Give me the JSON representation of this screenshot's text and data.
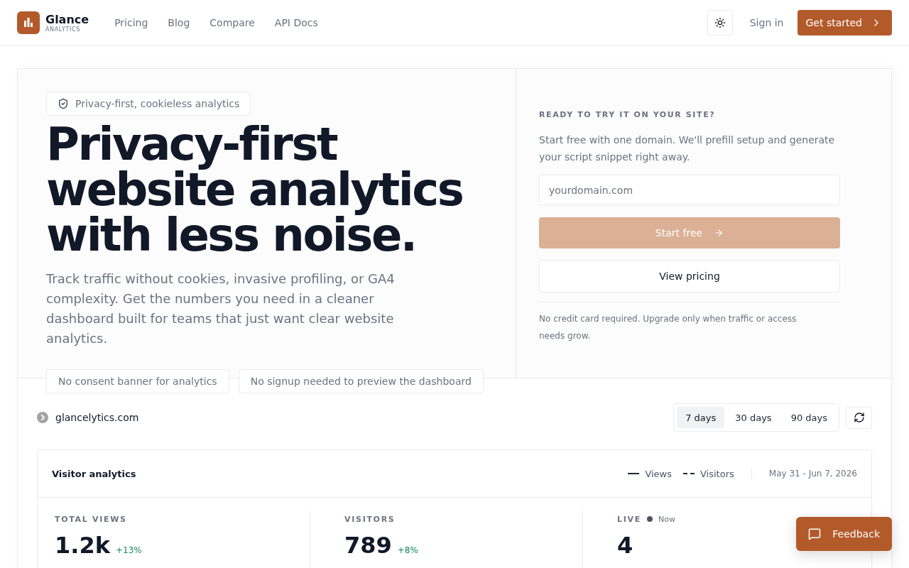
{
  "header": {
    "brand": {
      "name": "Glance",
      "tagline": "ANALYTICS"
    },
    "nav": [
      "Pricing",
      "Blog",
      "Compare",
      "API Docs"
    ],
    "sign_in": "Sign in",
    "cta": "Get started"
  },
  "hero": {
    "badge": "Privacy-first, cookieless analytics",
    "headline": "Privacy-first website analytics with less noise.",
    "description": "Track traffic without cookies, invasive profiling, or GA4 complexity. Get the numbers you need in a cleaner dashboard built for teams that just want clear website analytics.",
    "points": [
      "No consent banner for analytics",
      "No signup needed to preview the dashboard"
    ]
  },
  "signup": {
    "eyebrow": "READY TO TRY IT ON YOUR SITE?",
    "text": "Start free with one domain. We'll prefill setup and generate your script snippet right away.",
    "domain_field": {
      "placeholder": "yourdomain.com"
    },
    "start_button": {
      "label": "Start free",
      "disabled": true
    },
    "pricing_button": "View pricing",
    "note": "No credit card required. Upgrade only when traffic or access needs grow."
  },
  "dashboard": {
    "site": "glancelytics.com",
    "ranges": [
      {
        "label": "7 days",
        "selected": true
      },
      {
        "label": "30 days",
        "selected": false
      },
      {
        "label": "90 days",
        "selected": false
      }
    ],
    "card": {
      "title": "Visitor analytics",
      "legend": [
        {
          "label": "Views",
          "kind": "solid"
        },
        {
          "label": "Visitors",
          "kind": "dashed"
        }
      ],
      "date_range": "May 31 - Jun 7, 2026"
    },
    "stats": [
      {
        "kind": "metric",
        "label": "TOTAL VIEWS",
        "value": "1.2k",
        "change": "+13%"
      },
      {
        "kind": "metric",
        "label": "VISITORS",
        "value": "789",
        "change": "+8%"
      },
      {
        "kind": "live",
        "label": "LIVE",
        "status": "Now",
        "value": "4"
      }
    ]
  },
  "feedback": "Feedback"
}
